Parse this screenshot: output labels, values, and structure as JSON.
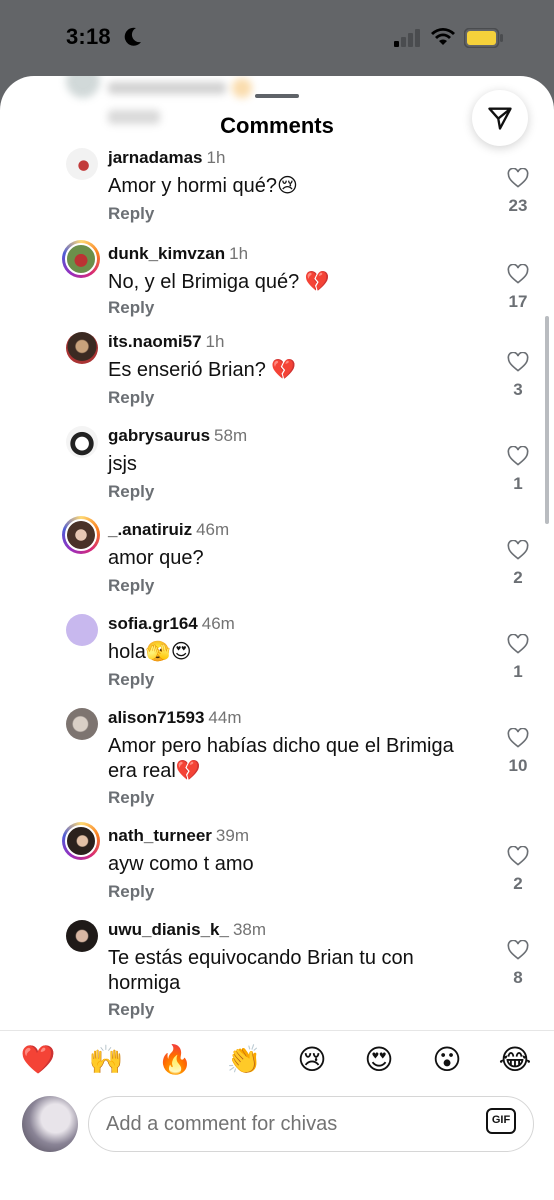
{
  "status": {
    "time": "3:18"
  },
  "sheet": {
    "title": "Comments"
  },
  "comments": [
    {
      "username": "jarnadamas",
      "time": "1h",
      "text": "Amor y hormi qué?😢",
      "reply": "Reply",
      "likes": "23"
    },
    {
      "username": "dunk_kimvzan",
      "time": "1h",
      "text": "No, y el Brimiga qué? 💔",
      "reply": "Reply",
      "likes": "17"
    },
    {
      "username": "its.naomi57",
      "time": "1h",
      "text": "Es enserió Brian? 💔",
      "reply": "Reply",
      "likes": "3"
    },
    {
      "username": "gabrysaurus",
      "time": "58m",
      "text": "jsjs",
      "reply": "Reply",
      "likes": "1"
    },
    {
      "username": "_.anatiruiz",
      "time": "46m",
      "text": "amor que?",
      "reply": "Reply",
      "likes": "2"
    },
    {
      "username": "sofia.gr164",
      "time": "46m",
      "text": "hola🫣😍",
      "reply": "Reply",
      "likes": "1"
    },
    {
      "username": "alison71593",
      "time": "44m",
      "text": "Amor pero habías dicho que el Brimiga era real💔",
      "reply": "Reply",
      "likes": "10"
    },
    {
      "username": "nath_turneer",
      "time": "39m",
      "text": "ayw como t amo",
      "reply": "Reply",
      "likes": "2"
    },
    {
      "username": "uwu_dianis_k_",
      "time": "38m",
      "text": "Te estás equivocando Brian tu con hormiga",
      "reply": "Reply",
      "likes": "8"
    }
  ],
  "reactions": [
    "❤️",
    "🙌",
    "🔥",
    "👏",
    "😢",
    "😍",
    "😮",
    "😂"
  ],
  "composer": {
    "placeholder": "Add a comment for chivas",
    "gif_label": "GIF"
  },
  "colors": {
    "accent": "#ed4956",
    "muted": "#737373",
    "ring_gradient": "instagram"
  }
}
